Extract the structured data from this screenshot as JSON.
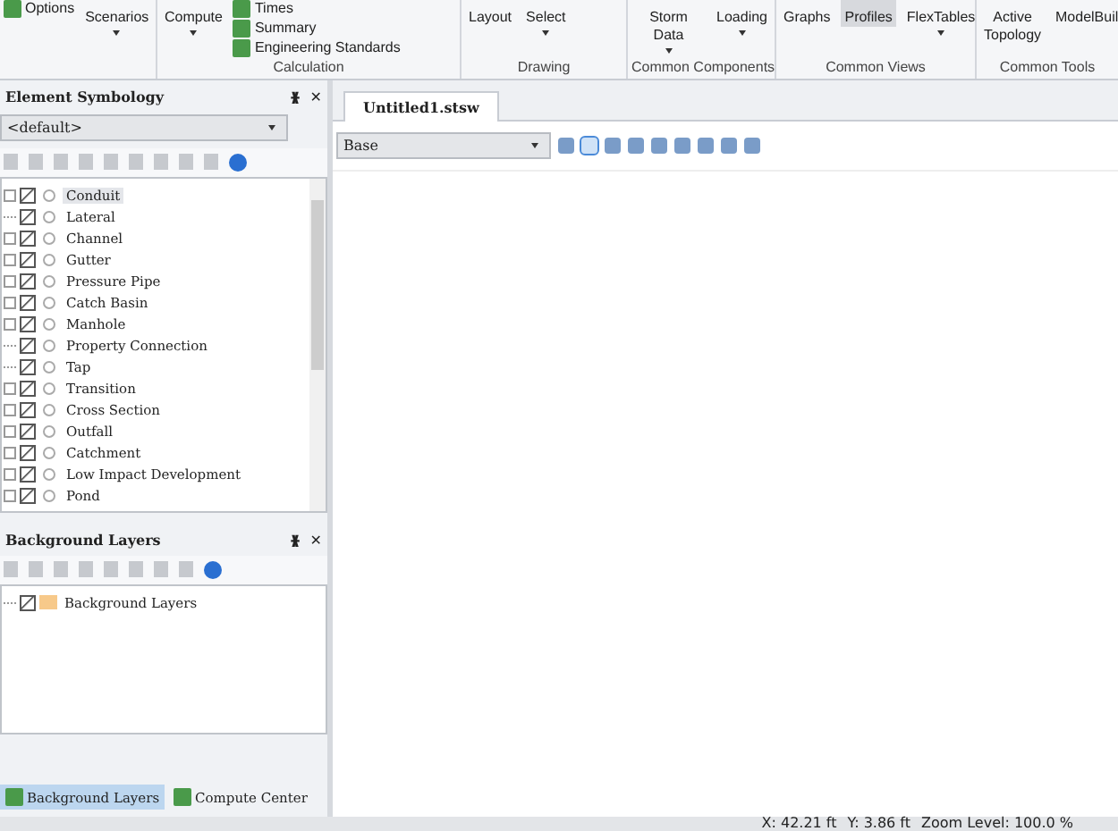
{
  "ribbon": {
    "groups": [
      {
        "items": [
          {
            "label": "Options",
            "kind": "small"
          },
          {
            "label": "Scenarios",
            "kind": "large",
            "dropdown": true
          }
        ]
      },
      {
        "label": "Calculation",
        "items": [
          {
            "label": "Compute",
            "kind": "large",
            "dropdown": true
          },
          {
            "label": "Times",
            "kind": "small"
          },
          {
            "label": "Summary",
            "kind": "small"
          },
          {
            "label": "Engineering Standards",
            "kind": "small"
          }
        ]
      },
      {
        "label": "Drawing",
        "items": [
          {
            "label": "Layout",
            "kind": "large",
            "dropdown": false
          },
          {
            "label": "Select",
            "kind": "large",
            "dropdown": true
          }
        ]
      },
      {
        "label": "Common Components",
        "items": [
          {
            "label": "Storm Data",
            "kind": "large",
            "dropdown": true
          },
          {
            "label": "Loading",
            "kind": "large",
            "dropdown": true
          }
        ]
      },
      {
        "label": "Common Views",
        "items": [
          {
            "label": "Graphs",
            "kind": "large",
            "dropdown": false,
            "selected": false
          },
          {
            "label": "Profiles",
            "kind": "large",
            "dropdown": false,
            "selected": true
          },
          {
            "label": "FlexTables",
            "kind": "large",
            "dropdown": true,
            "selected": false
          }
        ]
      },
      {
        "label": "Common Tools",
        "items": [
          {
            "label": "Active Topology",
            "kind": "large",
            "dropdown": false
          },
          {
            "label": "ModelBuil",
            "kind": "large",
            "dropdown": false
          }
        ]
      }
    ]
  },
  "element_symbology": {
    "title": "Element Symbology",
    "pin": "ᚕ",
    "close": "✕",
    "dropdown": "<default>",
    "items": [
      {
        "label": "Conduit",
        "checked": true,
        "expandable": true,
        "selected": true
      },
      {
        "label": "Lateral",
        "checked": true,
        "expandable": false,
        "selected": false
      },
      {
        "label": "Channel",
        "checked": true,
        "expandable": true,
        "selected": false
      },
      {
        "label": "Gutter",
        "checked": true,
        "expandable": true,
        "selected": false
      },
      {
        "label": "Pressure Pipe",
        "checked": true,
        "expandable": true,
        "selected": false
      },
      {
        "label": "Catch Basin",
        "checked": true,
        "expandable": true,
        "selected": false
      },
      {
        "label": "Manhole",
        "checked": true,
        "expandable": true,
        "selected": false
      },
      {
        "label": "Property Connection",
        "checked": true,
        "expandable": false,
        "selected": false
      },
      {
        "label": "Tap",
        "checked": true,
        "expandable": false,
        "selected": false
      },
      {
        "label": "Transition",
        "checked": true,
        "expandable": true,
        "selected": false
      },
      {
        "label": "Cross Section",
        "checked": true,
        "expandable": true,
        "selected": false
      },
      {
        "label": "Outfall",
        "checked": true,
        "expandable": true,
        "selected": false
      },
      {
        "label": "Catchment",
        "checked": true,
        "expandable": true,
        "selected": false
      },
      {
        "label": "Low Impact Development",
        "checked": true,
        "expandable": true,
        "selected": false
      },
      {
        "label": "Pond",
        "checked": true,
        "expandable": true,
        "selected": false
      }
    ]
  },
  "background_layers": {
    "title": "Background Layers",
    "pin": "ᚕ",
    "close": "✕",
    "items": [
      {
        "label": "Background Layers",
        "checked": true
      }
    ]
  },
  "bottom_tabs": [
    {
      "label": "Background Layers",
      "selected": true
    },
    {
      "label": "Compute Center",
      "selected": false
    }
  ],
  "document": {
    "tab": "Untitled1.stsw",
    "scenario": "Base"
  },
  "status_bar": [
    "X: 42.21 ft",
    "Y: 3.86 ft",
    "Zoom Level: 100.0 %"
  ]
}
